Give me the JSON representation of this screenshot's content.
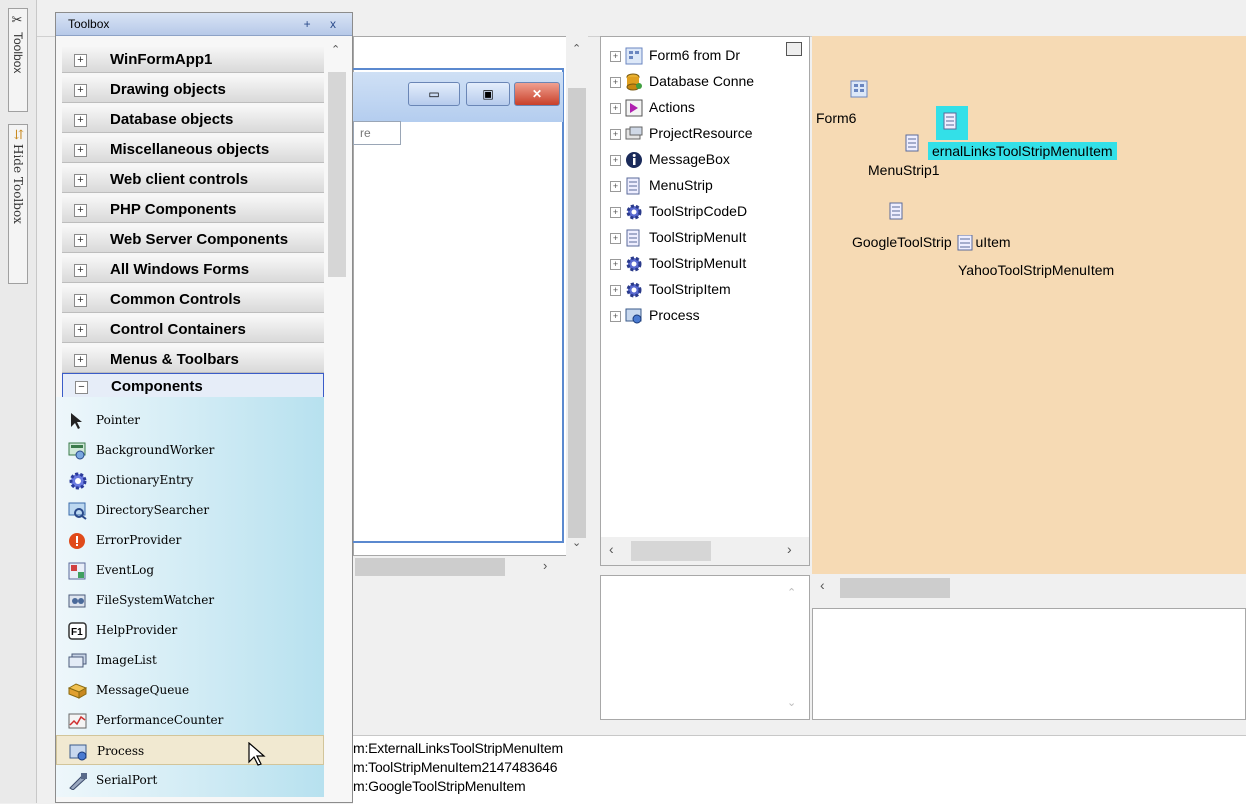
{
  "side_tabs": {
    "toolbox_label": "Toolbox",
    "hide_label": "Hide Toolbox"
  },
  "toolbox": {
    "title": "Toolbox",
    "title_buttons": "+ x",
    "categories": [
      {
        "label": "WinFormApp1",
        "state": "+"
      },
      {
        "label": "Drawing objects",
        "state": "+"
      },
      {
        "label": "Database objects",
        "state": "+"
      },
      {
        "label": "Miscellaneous objects",
        "state": "+"
      },
      {
        "label": "Web client controls",
        "state": "+"
      },
      {
        "label": "PHP Components",
        "state": "+"
      },
      {
        "label": "Web Server Components",
        "state": "+"
      },
      {
        "label": "All Windows Forms",
        "state": "+"
      },
      {
        "label": "Common Controls",
        "state": "+"
      },
      {
        "label": "Control Containers",
        "state": "+"
      },
      {
        "label": "Menus & Toolbars",
        "state": "+"
      },
      {
        "label": "Components",
        "state": "−"
      }
    ],
    "items": [
      {
        "label": "Pointer",
        "icon": "pointer-icon"
      },
      {
        "label": "BackgroundWorker",
        "icon": "background-worker-icon"
      },
      {
        "label": "DictionaryEntry",
        "icon": "gear-icon"
      },
      {
        "label": "DirectorySearcher",
        "icon": "directory-searcher-icon"
      },
      {
        "label": "ErrorProvider",
        "icon": "error-icon"
      },
      {
        "label": "EventLog",
        "icon": "event-log-icon"
      },
      {
        "label": "FileSystemWatcher",
        "icon": "file-watcher-icon"
      },
      {
        "label": "HelpProvider",
        "icon": "f1-help-icon"
      },
      {
        "label": "ImageList",
        "icon": "image-list-icon"
      },
      {
        "label": "MessageQueue",
        "icon": "message-queue-icon"
      },
      {
        "label": "PerformanceCounter",
        "icon": "performance-counter-icon"
      },
      {
        "label": "Process",
        "icon": "process-icon"
      },
      {
        "label": "SerialPort",
        "icon": "serial-port-icon"
      }
    ],
    "highlighted_item": "Process"
  },
  "form_preview": {
    "textbox_text": "re"
  },
  "tree": {
    "nodes": [
      {
        "label": "Form6 from Dr",
        "icon": "form-icon"
      },
      {
        "label": "Database Conne",
        "icon": "database-icon"
      },
      {
        "label": "Actions",
        "icon": "actions-icon"
      },
      {
        "label": "ProjectResource",
        "icon": "resources-icon"
      },
      {
        "label": "MessageBox",
        "icon": "info-icon"
      },
      {
        "label": "MenuStrip",
        "icon": "menustrip-icon"
      },
      {
        "label": "ToolStripCodeD",
        "icon": "gear-icon"
      },
      {
        "label": "ToolStripMenuIt",
        "icon": "menustrip-icon"
      },
      {
        "label": "ToolStripMenuIt",
        "icon": "gear-icon"
      },
      {
        "label": "ToolStripItem",
        "icon": "gear-icon"
      },
      {
        "label": "Process",
        "icon": "process-icon"
      }
    ]
  },
  "canvas": {
    "form_label": "Form6",
    "selected_label": "ernalLinksToolStripMenuItem",
    "menustrip_label": "MenuStrip1",
    "google_label": "GoogleToolStrip",
    "google_tail": "uItem",
    "yahoo_label": "YahooToolStripMenuItem",
    "bg_color": "#f6dab4",
    "selection_color": "#33e0e8"
  },
  "output": {
    "lines": [
      "m:ExternalLinksToolStripMenuItem",
      "m:ToolStripMenuItem2147483646",
      "m:GoogleToolStripMenuItem"
    ]
  }
}
